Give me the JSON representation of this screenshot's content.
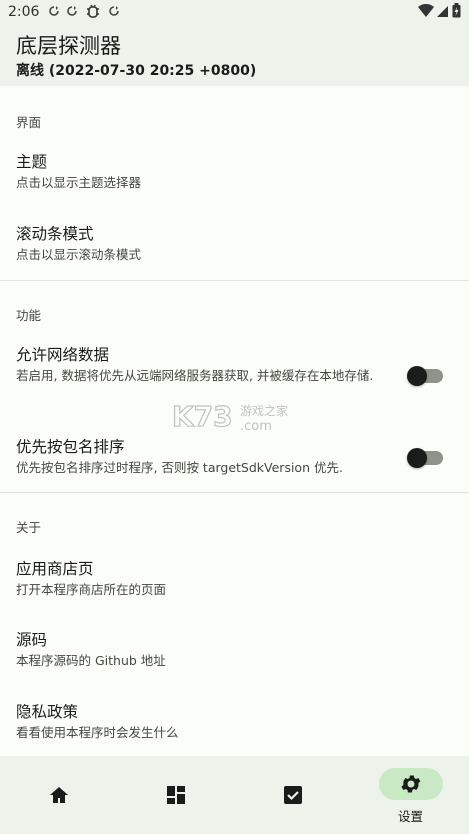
{
  "status_bar": {
    "time": "2:06"
  },
  "header": {
    "title": "底层探测器",
    "subtitle": "离线 (2022-07-30 20:25 +0800)"
  },
  "sections": {
    "interface": {
      "header": "界面",
      "theme": {
        "title": "主题",
        "summary": "点击以显示主题选择器"
      },
      "scrollbar": {
        "title": "滚动条模式",
        "summary": "点击以显示滚动条模式"
      }
    },
    "features": {
      "header": "功能",
      "network": {
        "title": "允许网络数据",
        "summary": "若启用, 数据将优先从远端网络服务器获取, 并被缓存在本地存储.",
        "enabled": false
      },
      "sort": {
        "title": "优先按包名排序",
        "summary": "优先按包名排序过时程序, 否则按 targetSdkVersion 优先.",
        "enabled": false
      }
    },
    "about": {
      "header": "关于",
      "store": {
        "title": "应用商店页",
        "summary": "打开本程序商店所在的页面"
      },
      "source": {
        "title": "源码",
        "summary": "本程序源码的 Github 地址"
      },
      "privacy": {
        "title": "隐私政策",
        "summary": "看看使用本程序时会发生什么"
      }
    }
  },
  "watermark": {
    "text": "K73",
    "site": "游戏之家",
    "domain": ".com"
  },
  "bottom_nav": {
    "items": [
      {
        "icon": "home-icon"
      },
      {
        "icon": "dashboard-icon"
      },
      {
        "icon": "checkbox-icon"
      },
      {
        "icon": "settings-icon",
        "label": "设置",
        "selected": true
      }
    ]
  },
  "colors": {
    "background": "#fbfdf8",
    "bar": "#edf2ea",
    "nav_selected": "#c9e9c4",
    "divider": "#dfe4db"
  }
}
